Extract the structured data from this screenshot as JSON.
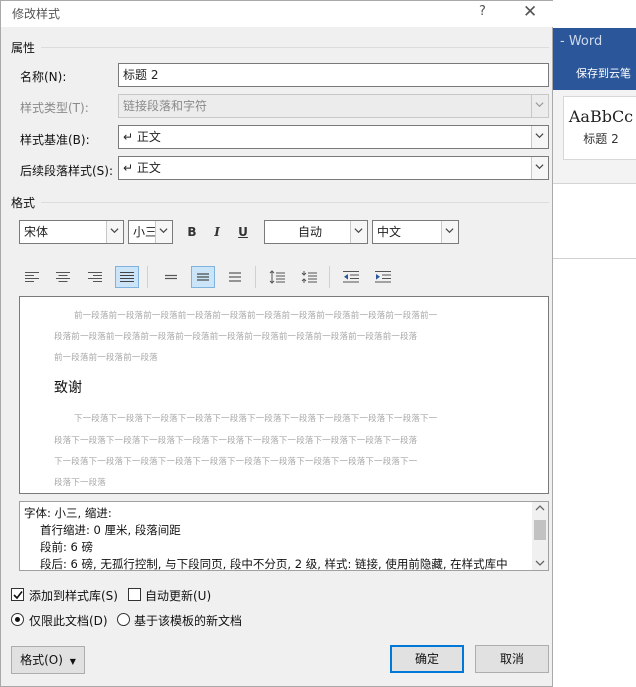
{
  "background_app": {
    "title_fragment": "- Word",
    "ribbon_button": "保存到云笔",
    "style_gallery": {
      "sample": "AaBbCc",
      "name": "标题 2"
    }
  },
  "dialog": {
    "title": "修改样式",
    "help": "?",
    "close": "✕"
  },
  "properties": {
    "section_title": "属性",
    "name_label": "名称(N):",
    "name_value": "标题 2",
    "type_label": "样式类型(T):",
    "type_value": "链接段落和字符",
    "base_label": "样式基准(B):",
    "base_value": "↵ 正文",
    "next_label": "后续段落样式(S):",
    "next_value": "↵ 正文"
  },
  "format": {
    "section_title": "格式",
    "font": "宋体",
    "size": "小三",
    "bold": "B",
    "italic": "I",
    "underline": "U",
    "color": "自动",
    "script": "中文"
  },
  "preview": {
    "prev_lines": [
      "前一段落前一段落前一段落前一段落前一段落前一段落前一段落前一段落前一段落前一段落前一",
      "段落前一段落前一段落前一段落前一段落前一段落前一段落前一段落前一段落前一段落前一段落",
      "前一段落前一段落前一段落"
    ],
    "sample_text": "致谢",
    "next_lines": [
      "下一段落下一段落下一段落下一段落下一段落下一段落下一段落下一段落下一段落下一段落下一",
      "段落下一段落下一段落下一段落下一段落下一段落下一段落下一段落下一段落下一段落下一段落",
      "下一段落下一段落下一段落下一段落下一段落下一段落下一段落下一段落下一段落下一段落下一",
      "段落下一段落"
    ]
  },
  "description": {
    "lines": [
      "字体: 小三, 缩进:",
      "首行缩进:  0 厘米, 段落间距",
      "段前: 6 磅",
      "段后: 6 磅, 无孤行控制, 与下段同页, 段中不分页, 2 级, 样式: 链接, 使用前隐藏, 在样式库中"
    ]
  },
  "options": {
    "add_to_gallery": "添加到样式库(S)",
    "add_to_gallery_checked": true,
    "auto_update": "自动更新(U)",
    "auto_update_checked": false,
    "only_this_doc": "仅限此文档(D)",
    "template_docs": "基于该模板的新文档",
    "selected_scope": "only_this_doc"
  },
  "buttons": {
    "format": "格式(O)",
    "ok": "确定",
    "cancel": "取消"
  },
  "colors": {
    "accent": "#0078d7",
    "word_blue": "#2b579a",
    "active_toggle": "#cce4f7"
  }
}
